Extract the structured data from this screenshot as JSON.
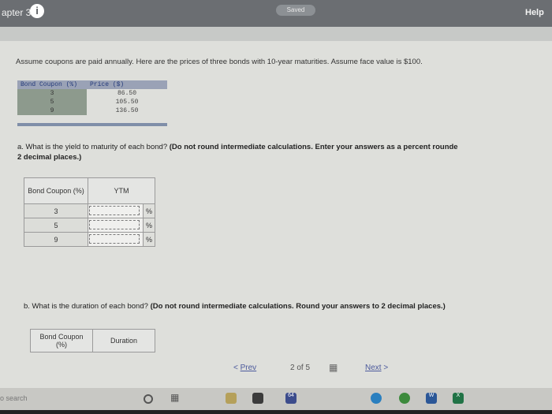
{
  "header": {
    "chapter": "apter 3",
    "info_icon": "info-icon",
    "saved": "Saved",
    "help": "Help"
  },
  "intro": "Assume coupons are paid annually. Here are the prices of three bonds with 10-year maturities. Assume face value is $100.",
  "given_table": {
    "headers": [
      "Bond Coupon (%)",
      "Price ($)"
    ],
    "rows": [
      [
        "3",
        "86.50"
      ],
      [
        "5",
        "105.50"
      ],
      [
        "9",
        "136.50"
      ]
    ]
  },
  "question_a": {
    "text": "a. What is the yield to maturity of each bond? ",
    "bold": "(Do not round intermediate calculations. Enter your answers as a percent rounde",
    "bold2": "2 decimal places.)"
  },
  "ytm_table": {
    "col1": "Bond Coupon (%)",
    "col2": "YTM",
    "rows": [
      {
        "coupon": "3",
        "value": "",
        "unit": "%"
      },
      {
        "coupon": "5",
        "value": "",
        "unit": "%"
      },
      {
        "coupon": "9",
        "value": "",
        "unit": "%"
      }
    ]
  },
  "question_b": {
    "text": "b. What is the duration of each bond? ",
    "bold": "(Do not round intermediate calculations. Round your answers to 2 decimal places.)"
  },
  "duration_table": {
    "col1": "Bond Coupon (%)",
    "col2": "Duration"
  },
  "pager": {
    "prev": "Prev",
    "current": "2",
    "of": "of",
    "total": "5",
    "next": "Next"
  },
  "taskbar": {
    "search": "o search",
    "mail_badge": "64",
    "word": "W",
    "excel": "X"
  }
}
